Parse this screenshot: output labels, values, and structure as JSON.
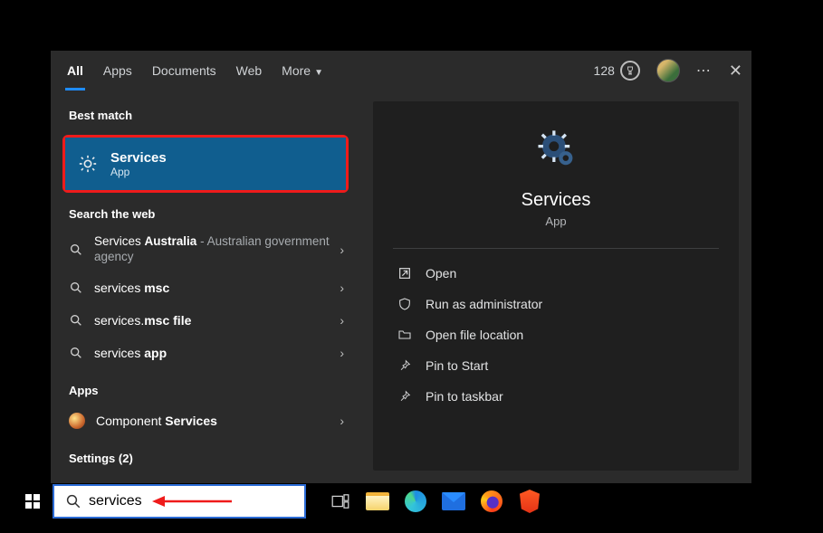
{
  "tabs": {
    "all": "All",
    "apps": "Apps",
    "documents": "Documents",
    "web": "Web",
    "more": "More"
  },
  "points": "128",
  "sections": {
    "best_match": "Best match",
    "search_web": "Search the web",
    "apps": "Apps",
    "settings": "Settings (2)"
  },
  "best_match": {
    "title": "Services",
    "subtitle": "App"
  },
  "web_results": [
    {
      "pre": "Services ",
      "accent": "Australia",
      "suffix_muted": " - Australian government agency"
    },
    {
      "pre": "services ",
      "accent": "msc",
      "suffix_muted": ""
    },
    {
      "pre": "services.",
      "accent": "msc file",
      "suffix_muted": ""
    },
    {
      "pre": "services ",
      "accent": "app",
      "suffix_muted": ""
    }
  ],
  "apps_results": {
    "component_pre": "Component ",
    "component_accent": "Services"
  },
  "preview": {
    "title": "Services",
    "subtitle": "App",
    "actions": {
      "open": "Open",
      "run_admin": "Run as administrator",
      "open_file_location": "Open file location",
      "pin_start": "Pin to Start",
      "pin_taskbar": "Pin to taskbar"
    }
  },
  "search": {
    "value": "services"
  }
}
